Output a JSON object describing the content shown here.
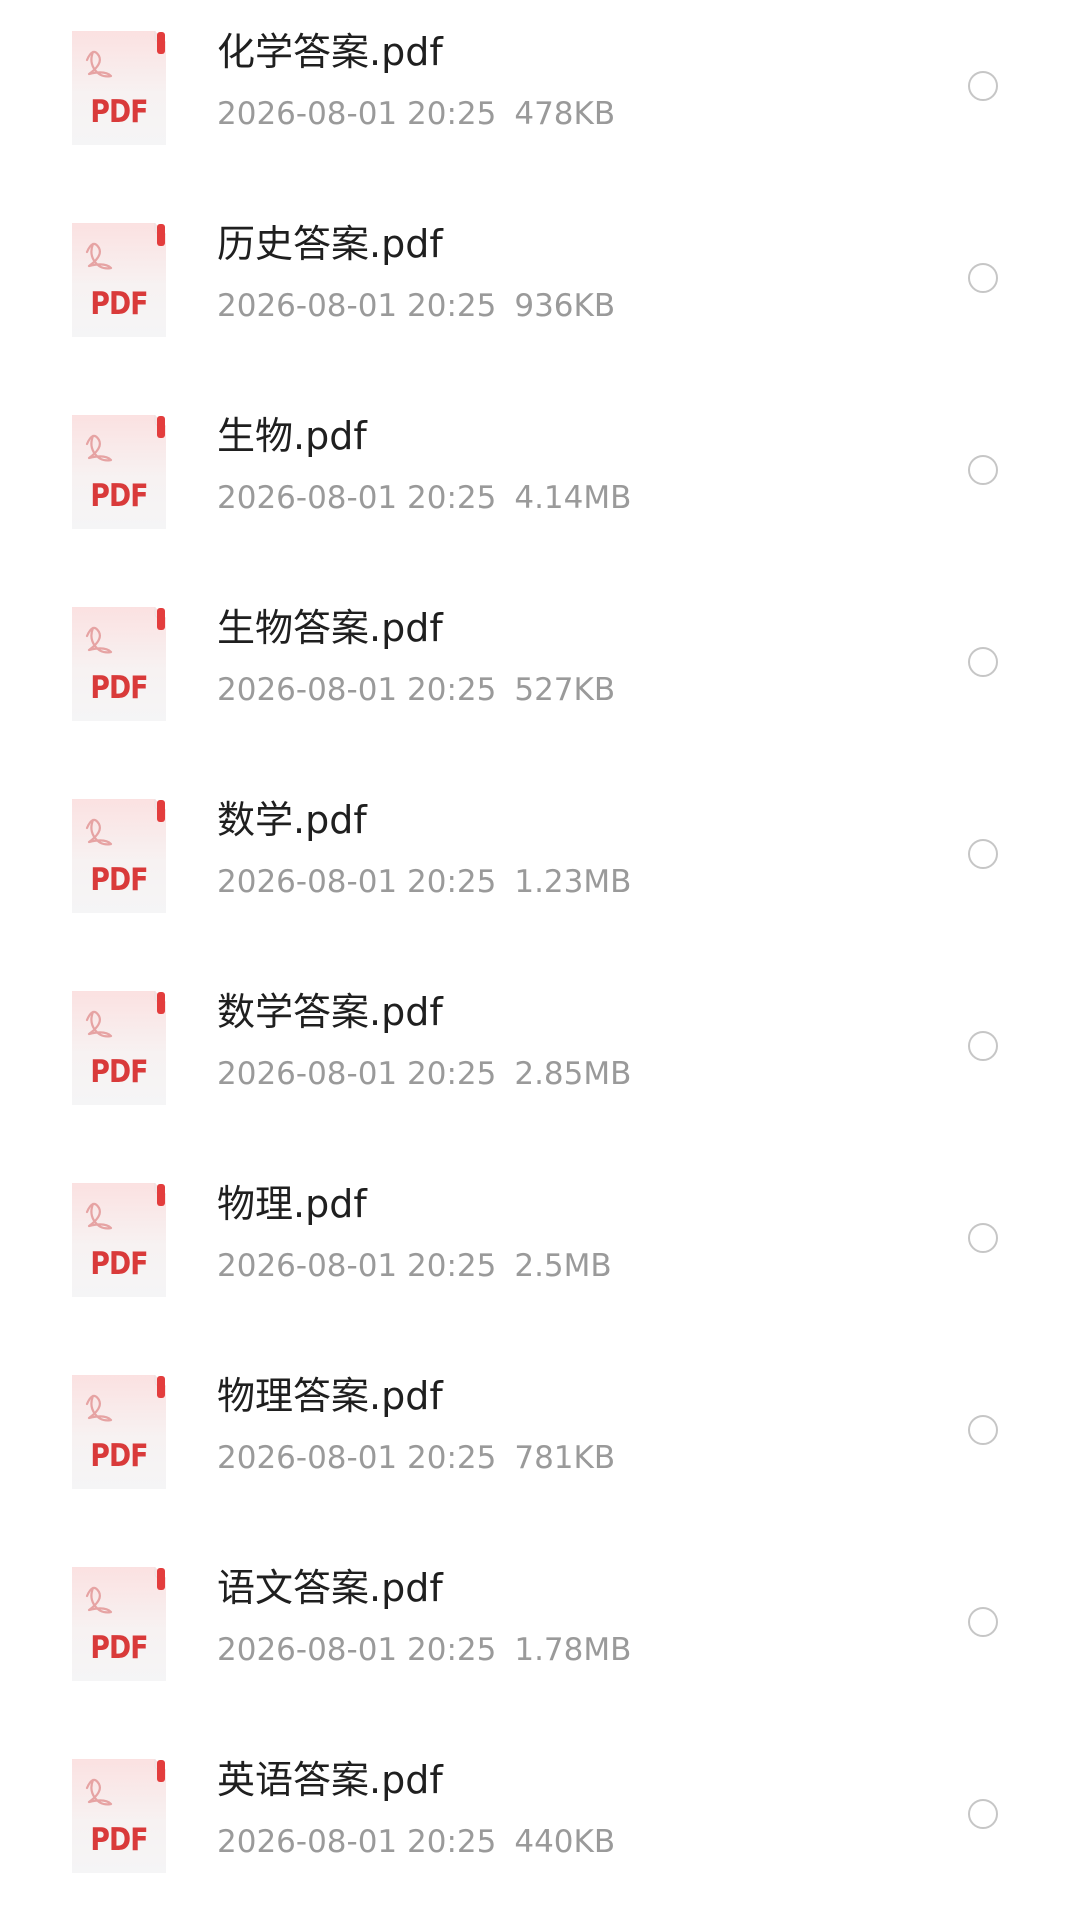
{
  "files": [
    {
      "name": "化学答案.pdf",
      "date": "2026-08-01 20:25",
      "size": "478KB",
      "badge": "PDF"
    },
    {
      "name": "历史答案.pdf",
      "date": "2026-08-01 20:25",
      "size": "936KB",
      "badge": "PDF"
    },
    {
      "name": "生物.pdf",
      "date": "2026-08-01 20:25",
      "size": "4.14MB",
      "badge": "PDF"
    },
    {
      "name": "生物答案.pdf",
      "date": "2026-08-01 20:25",
      "size": "527KB",
      "badge": "PDF"
    },
    {
      "name": "数学.pdf",
      "date": "2026-08-01 20:25",
      "size": "1.23MB",
      "badge": "PDF"
    },
    {
      "name": "数学答案.pdf",
      "date": "2026-08-01 20:25",
      "size": "2.85MB",
      "badge": "PDF"
    },
    {
      "name": "物理.pdf",
      "date": "2026-08-01 20:25",
      "size": "2.5MB",
      "badge": "PDF"
    },
    {
      "name": "物理答案.pdf",
      "date": "2026-08-01 20:25",
      "size": "781KB",
      "badge": "PDF"
    },
    {
      "name": "语文答案.pdf",
      "date": "2026-08-01 20:25",
      "size": "1.78MB",
      "badge": "PDF"
    },
    {
      "name": "英语答案.pdf",
      "date": "2026-08-01 20:25",
      "size": "440KB",
      "badge": "PDF"
    }
  ],
  "icons": {
    "file_icon": "pdf-file-icon",
    "select_icon": "radio-circle-icon"
  },
  "colors": {
    "pdf_red": "#d93a3a",
    "name_text": "#1f1f1f",
    "meta_text": "#9a9a9a",
    "radio_border": "#c6c6c6"
  }
}
